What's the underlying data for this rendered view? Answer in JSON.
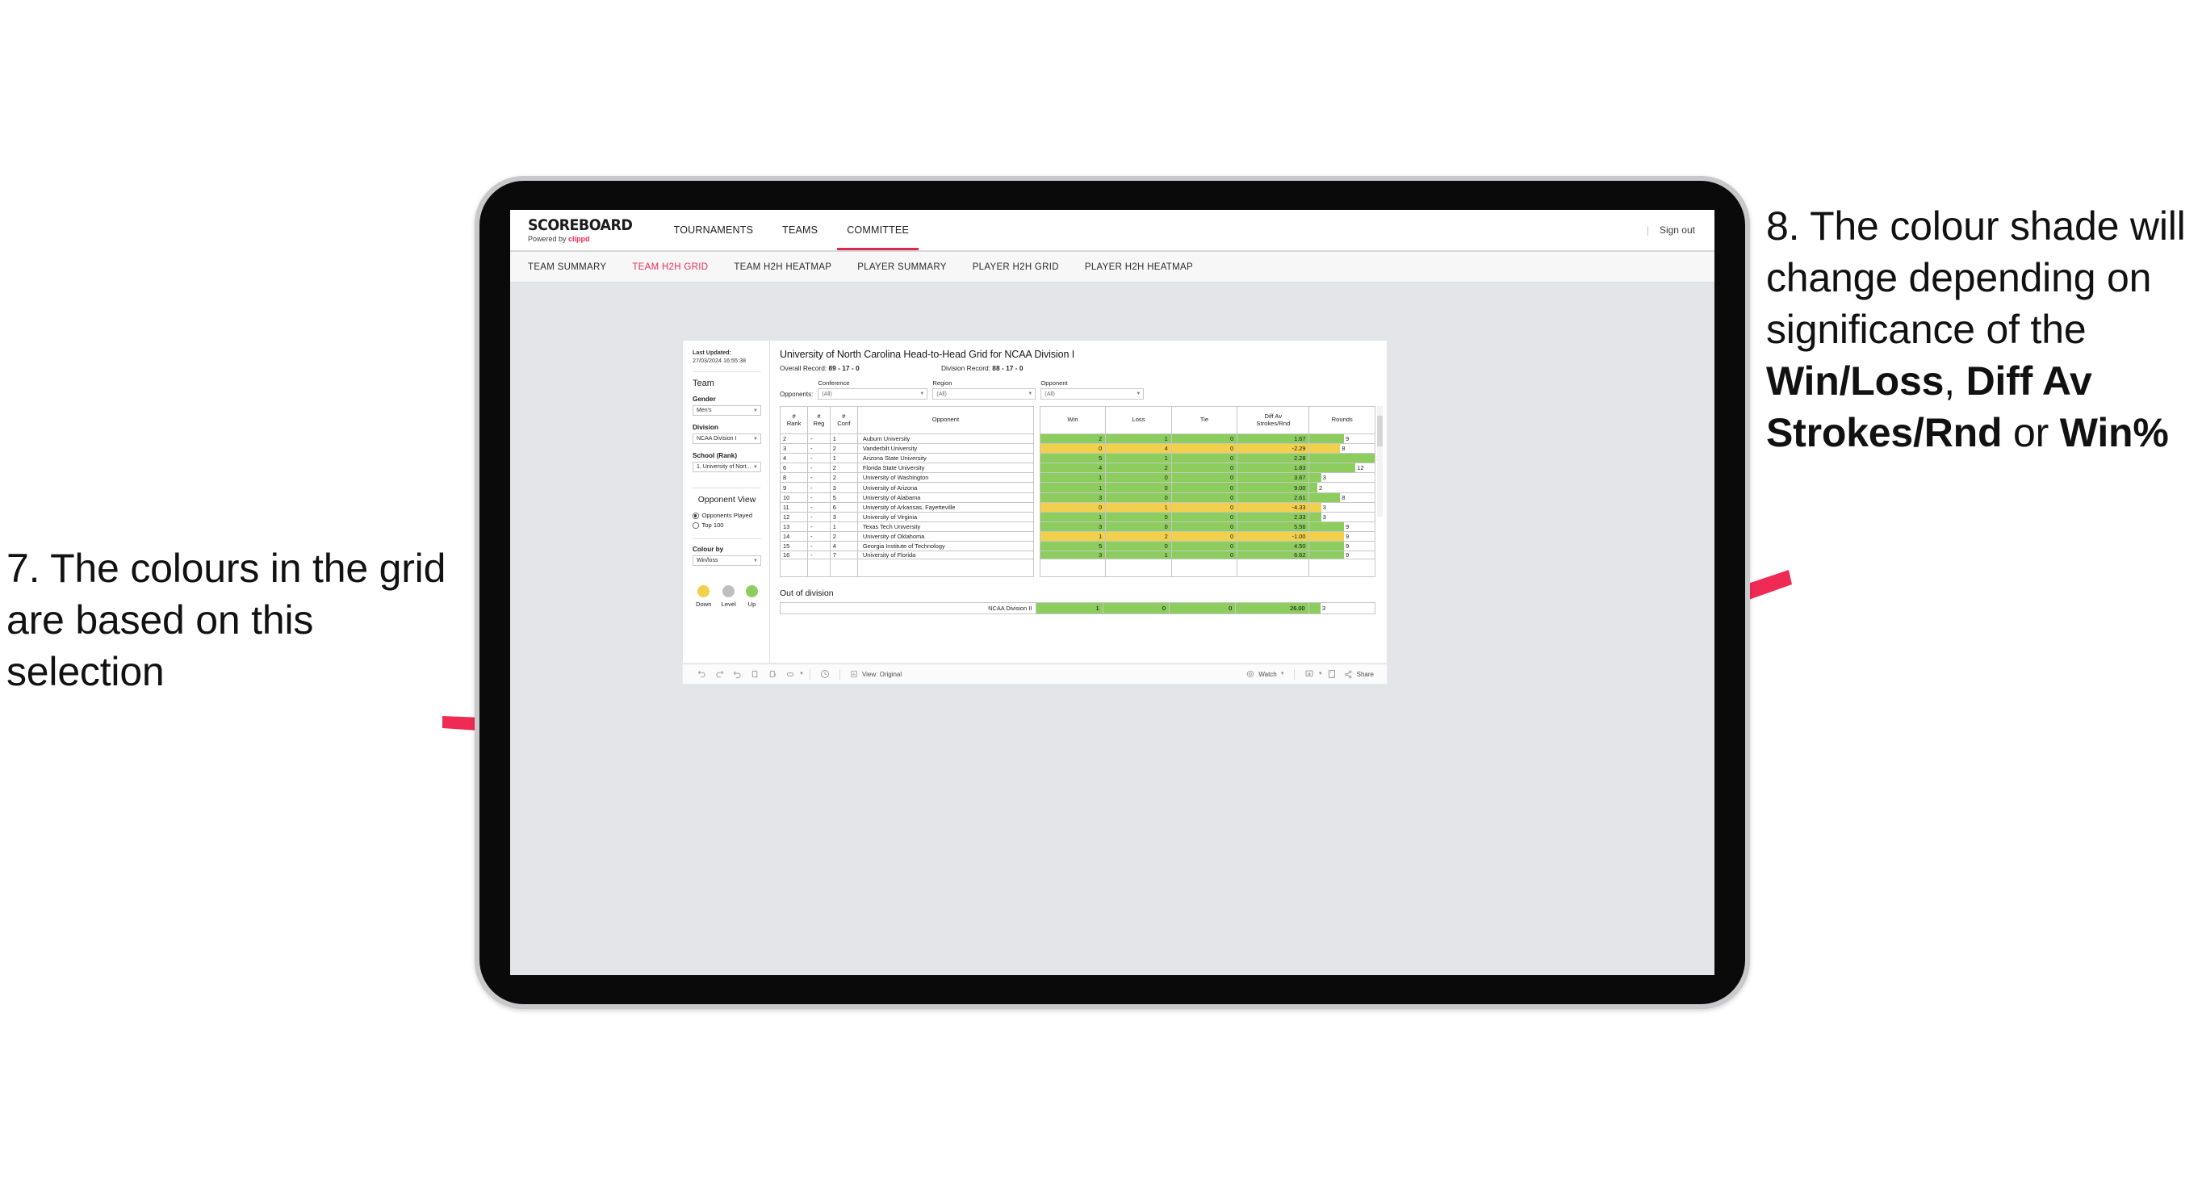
{
  "annotations": {
    "left": "7. The colours in the grid are based on this selection",
    "right_parts": [
      {
        "text": "8. The colour shade will change depending on significance of the ",
        "bold": false
      },
      {
        "text": "Win/Loss",
        "bold": true
      },
      {
        "text": ", ",
        "bold": false
      },
      {
        "text": "Diff Av Strokes/Rnd",
        "bold": true
      },
      {
        "text": " or ",
        "bold": false
      },
      {
        "text": "Win%",
        "bold": true
      }
    ],
    "arrow_color": "#ef2b55"
  },
  "app": {
    "brand": {
      "title": "SCOREBOARD",
      "powered_prefix": "Powered by ",
      "powered_name": "clippd"
    },
    "topnav": [
      {
        "label": "TOURNAMENTS",
        "active": false
      },
      {
        "label": "TEAMS",
        "active": false
      },
      {
        "label": "COMMITTEE",
        "active": true
      }
    ],
    "signout": {
      "divider": "|",
      "label": "Sign out"
    },
    "subnav": [
      {
        "label": "TEAM SUMMARY",
        "active": false
      },
      {
        "label": "TEAM H2H GRID",
        "active": true
      },
      {
        "label": "TEAM H2H HEATMAP",
        "active": false
      },
      {
        "label": "PLAYER SUMMARY",
        "active": false
      },
      {
        "label": "PLAYER H2H GRID",
        "active": false
      },
      {
        "label": "PLAYER H2H HEATMAP",
        "active": false
      }
    ]
  },
  "sidebar": {
    "last_updated_label": "Last Updated:",
    "last_updated_value": " 27/03/2024 16:55:38",
    "team_heading": "Team",
    "fields": [
      {
        "label": "Gender",
        "value": "Men's"
      },
      {
        "label": "Division",
        "value": "NCAA Division I"
      },
      {
        "label": "School (Rank)",
        "value": "1. University of Nort..."
      }
    ],
    "opponent_view_heading": "Opponent View",
    "opponent_view_options": [
      {
        "label": "Opponents Played",
        "selected": true
      },
      {
        "label": "Top 100",
        "selected": false
      }
    ],
    "colour_by_label": "Colour by",
    "colour_by_value": "Win/loss",
    "legend": [
      {
        "label": "Down",
        "color": "#f2d04b"
      },
      {
        "label": "Level",
        "color": "#bfbfc2"
      },
      {
        "label": "Up",
        "color": "#8ccd5e"
      }
    ]
  },
  "report": {
    "title": "University of North Carolina Head-to-Head Grid for NCAA Division I",
    "overall_record_label": "Overall Record:",
    "overall_record_value": " 89 - 17 - 0",
    "division_record_label": "Division Record:",
    "division_record_value": " 88 - 17 - 0",
    "opponents_label": "Opponents:",
    "filters": [
      {
        "label": "Conference",
        "value": "(All)"
      },
      {
        "label": "Region",
        "value": "(All)"
      },
      {
        "label": "Opponent",
        "value": "(All)"
      }
    ],
    "out_of_division_title": "Out of division"
  },
  "chart_data": {
    "type": "table",
    "title": "University of North Carolina Head-to-Head Grid for NCAA Division I",
    "columns": [
      "# Rank",
      "# Reg",
      "# Conf",
      "Opponent",
      "Win",
      "Loss",
      "Tie",
      "Diff Av Strokes/Rnd",
      "Rounds"
    ],
    "column_header_lines": [
      [
        "#",
        "Rank"
      ],
      [
        "#",
        "Reg"
      ],
      [
        "#",
        "Conf"
      ],
      [
        "Opponent"
      ],
      [
        "Win"
      ],
      [
        "Loss"
      ],
      [
        "Tie"
      ],
      [
        "Diff Av",
        "Strokes/Rnd"
      ],
      [
        "Rounds"
      ]
    ],
    "rounds_max": 17,
    "colors": {
      "up": "#8ccd5e",
      "down": "#f2d04b",
      "level": "#bfbfc2"
    },
    "rows": [
      {
        "rank": "2",
        "reg": "-",
        "conf": "1",
        "opponent": "Auburn University",
        "win": "2",
        "loss": "1",
        "tie": "0",
        "diff": "1.67",
        "rounds": "9",
        "state": "up"
      },
      {
        "rank": "3",
        "reg": "-",
        "conf": "2",
        "opponent": "Vanderbilt University",
        "win": "0",
        "loss": "4",
        "tie": "0",
        "diff": "-2.29",
        "rounds": "8",
        "state": "down"
      },
      {
        "rank": "4",
        "reg": "-",
        "conf": "1",
        "opponent": "Arizona State University",
        "win": "5",
        "loss": "1",
        "tie": "0",
        "diff": "2.28",
        "rounds": "17",
        "state": "up"
      },
      {
        "rank": "6",
        "reg": "-",
        "conf": "2",
        "opponent": "Florida State University",
        "win": "4",
        "loss": "2",
        "tie": "0",
        "diff": "1.83",
        "rounds": "12",
        "state": "up"
      },
      {
        "rank": "8",
        "reg": "-",
        "conf": "2",
        "opponent": "University of Washington",
        "win": "1",
        "loss": "0",
        "tie": "0",
        "diff": "3.67",
        "rounds": "3",
        "state": "up"
      },
      {
        "rank": "9",
        "reg": "-",
        "conf": "3",
        "opponent": "University of Arizona",
        "win": "1",
        "loss": "0",
        "tie": "0",
        "diff": "9.00",
        "rounds": "2",
        "state": "up"
      },
      {
        "rank": "10",
        "reg": "-",
        "conf": "5",
        "opponent": "University of Alabama",
        "win": "3",
        "loss": "0",
        "tie": "0",
        "diff": "2.61",
        "rounds": "8",
        "state": "up"
      },
      {
        "rank": "11",
        "reg": "-",
        "conf": "6",
        "opponent": "University of Arkansas, Fayetteville",
        "win": "0",
        "loss": "1",
        "tie": "0",
        "diff": "-4.33",
        "rounds": "3",
        "state": "down"
      },
      {
        "rank": "12",
        "reg": "-",
        "conf": "3",
        "opponent": "University of Virginia",
        "win": "1",
        "loss": "0",
        "tie": "0",
        "diff": "2.33",
        "rounds": "3",
        "state": "up"
      },
      {
        "rank": "13",
        "reg": "-",
        "conf": "1",
        "opponent": "Texas Tech University",
        "win": "3",
        "loss": "0",
        "tie": "0",
        "diff": "5.56",
        "rounds": "9",
        "state": "up"
      },
      {
        "rank": "14",
        "reg": "-",
        "conf": "2",
        "opponent": "University of Oklahoma",
        "win": "1",
        "loss": "2",
        "tie": "0",
        "diff": "-1.00",
        "rounds": "9",
        "state": "down"
      },
      {
        "rank": "15",
        "reg": "-",
        "conf": "4",
        "opponent": "Georgia Institute of Technology",
        "win": "5",
        "loss": "0",
        "tie": "0",
        "diff": "4.50",
        "rounds": "9",
        "state": "up"
      },
      {
        "rank": "16",
        "reg": "-",
        "conf": "7",
        "opponent": "University of Florida",
        "win": "3",
        "loss": "1",
        "tie": "0",
        "diff": "6.62",
        "rounds": "9",
        "state": "up"
      }
    ],
    "out_of_division": [
      {
        "name": "NCAA Division II",
        "win": "1",
        "loss": "0",
        "tie": "0",
        "diff": "26.00",
        "rounds": "3",
        "state": "up"
      }
    ]
  },
  "toolbar": {
    "view_label": "View: Original",
    "watch_label": "Watch",
    "share_label": "Share"
  }
}
